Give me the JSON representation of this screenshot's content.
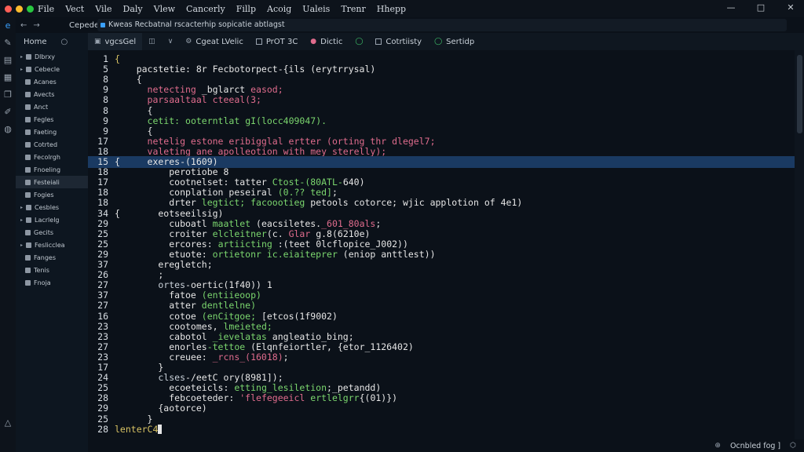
{
  "window": {
    "traffic_lights": [
      "#ff5f57",
      "#febc2e",
      "#28c840"
    ],
    "menu": [
      "File",
      "Vect",
      "Vile",
      "Daly",
      "Vlew",
      "Cancerly",
      "Fillp",
      "Acoig",
      "Ualeis",
      "Trenr",
      "Hhepp"
    ],
    "controls": [
      "—",
      "□",
      "✕"
    ]
  },
  "address_bar": {
    "nav": [
      "←",
      "→"
    ],
    "crumb": "Cepedel",
    "text": "Kweas Recbatnal rscacterhip sopicatie abtlagst"
  },
  "sidebar": {
    "title": "Home",
    "items": [
      {
        "label": "Dlbrxy",
        "indent": 0,
        "arrow": true
      },
      {
        "label": "Cebecle",
        "indent": 0,
        "arrow": true
      },
      {
        "label": "Acanes",
        "indent": 1
      },
      {
        "label": "Avects",
        "indent": 1
      },
      {
        "label": "Anct",
        "indent": 1
      },
      {
        "label": "Fegles",
        "indent": 1
      },
      {
        "label": "Faeting",
        "indent": 1
      },
      {
        "label": "Cotrted",
        "indent": 1
      },
      {
        "label": "Fecolrgh",
        "indent": 1
      },
      {
        "label": "Fnoeling",
        "indent": 1
      },
      {
        "label": "Festeiali",
        "indent": 1,
        "selected": true
      },
      {
        "label": "Fogies",
        "indent": 1
      },
      {
        "label": "Cesbles",
        "indent": 0,
        "arrow": true
      },
      {
        "label": "Lacrlelg",
        "indent": 0,
        "arrow": true
      },
      {
        "label": "Gecits",
        "indent": 1
      },
      {
        "label": "Feslicclea",
        "indent": 0,
        "arrow": true
      },
      {
        "label": "Fanges",
        "indent": 1
      },
      {
        "label": "Tenis",
        "indent": 1
      },
      {
        "label": "Fnoja",
        "indent": 1
      }
    ]
  },
  "tabs": [
    {
      "label": "vgcsGel",
      "icon": "doc",
      "active": true
    },
    {
      "label": "",
      "icon": "split"
    },
    {
      "label": "",
      "icon": "dropdown"
    },
    {
      "label": "Cgeat LVelic",
      "icon": "gear"
    },
    {
      "label": "PrOT 3C",
      "icon": "box"
    },
    {
      "label": "Dictic",
      "icon": "pink-dot"
    },
    {
      "label": "",
      "icon": "green-circle"
    },
    {
      "label": "Cotrtiisty",
      "icon": "box"
    },
    {
      "label": "Sertidp",
      "icon": "green-circle"
    }
  ],
  "editor": {
    "lines": [
      {
        "n": "1",
        "code": [
          [
            "{",
            "y"
          ]
        ]
      },
      {
        "n": "5",
        "code": [
          [
            "    pacstetie: 8r Fecbotorpect-{ils (erytrrysal)",
            "k"
          ]
        ]
      },
      {
        "n": "8",
        "code": [
          [
            "    {",
            "k"
          ]
        ]
      },
      {
        "n": "9",
        "code": [
          [
            "      netecting ",
            "r"
          ],
          [
            "_bglarct",
            "k"
          ],
          [
            " easod;",
            "r"
          ]
        ]
      },
      {
        "n": "8",
        "code": [
          [
            "      parsaaltaal cteeal(3;",
            "r"
          ]
        ]
      },
      {
        "n": "8",
        "code": [
          [
            "      {",
            "k"
          ]
        ]
      },
      {
        "n": "9",
        "code": [
          [
            "      cetit: ",
            "g"
          ],
          [
            "ooterntlat",
            "g"
          ],
          [
            " gI(locc409047).",
            "g"
          ]
        ]
      },
      {
        "n": "9",
        "code": [
          [
            "      {",
            "k"
          ]
        ]
      },
      {
        "n": "17",
        "code": [
          [
            "      netelig estone eribigglal ertter (orting thr dlegel7;",
            "r"
          ]
        ]
      },
      {
        "n": "18",
        "code": [
          [
            "      valeting ane apolleotion with mey sterelly);",
            "r"
          ]
        ]
      },
      {
        "n": "15",
        "hl": true,
        "code": [
          [
            "{     ",
            "k"
          ],
          [
            "exeres-(1609)",
            "k"
          ]
        ]
      },
      {
        "n": "18",
        "code": [
          [
            "          perotiobe 8",
            "k"
          ]
        ]
      },
      {
        "n": "17",
        "code": [
          [
            "          cootnelset: tatter ",
            "k"
          ],
          [
            "Ctost-(80ATL-",
            "g"
          ],
          [
            "640)",
            "k"
          ]
        ]
      },
      {
        "n": "18",
        "code": [
          [
            "          conplation peseiral ",
            "k"
          ],
          [
            "(0.?? ted]",
            "g"
          ],
          [
            ";",
            "k"
          ]
        ]
      },
      {
        "n": "18",
        "code": [
          [
            "          drter ",
            "k"
          ],
          [
            "legtict; facoootieg",
            "g"
          ],
          [
            " petools cotorce; wjic applotion of 4e1)",
            "k"
          ]
        ]
      },
      {
        "n": "34",
        "code": [
          [
            "{       eotseeilsig)",
            "k"
          ]
        ]
      },
      {
        "n": "29",
        "code": [
          [
            "          cuboatl ",
            "k"
          ],
          [
            "maatlet",
            "g"
          ],
          [
            " (eacsiletes.",
            "k"
          ],
          [
            "_601_80als",
            "r"
          ],
          [
            ";",
            "k"
          ]
        ]
      },
      {
        "n": "25",
        "code": [
          [
            "          croiter ",
            "k"
          ],
          [
            "elcleitner",
            "g"
          ],
          [
            "(c. ",
            "k"
          ],
          [
            "Glar",
            "r"
          ],
          [
            " g.8(6210e)",
            "k"
          ]
        ]
      },
      {
        "n": "25",
        "code": [
          [
            "          ercores: ",
            "k"
          ],
          [
            "artiicting",
            "g"
          ],
          [
            " :(teet 0lcflopice_J002))",
            "k"
          ]
        ]
      },
      {
        "n": "29",
        "code": [
          [
            "          etuote: ",
            "k"
          ],
          [
            "ortietonr",
            "g"
          ],
          [
            " ic.eiaiteprer",
            "g"
          ],
          [
            " (eniop anttlest))",
            "k"
          ]
        ]
      },
      {
        "n": "37",
        "code": [
          [
            "        eregletch;",
            "k"
          ]
        ]
      },
      {
        "n": "26",
        "code": [
          [
            "        ;",
            "k"
          ]
        ]
      },
      {
        "n": "27",
        "code": [
          [
            "        ",
            "k"
          ],
          [
            "ortes",
            "b"
          ],
          [
            "-oertic(1f40)) 1",
            "k"
          ]
        ]
      },
      {
        "n": "37",
        "code": [
          [
            "          fatoe ",
            "k"
          ],
          [
            "(entiieoop)",
            "g"
          ]
        ]
      },
      {
        "n": "27",
        "code": [
          [
            "          atter ",
            "k"
          ],
          [
            "dentlelne)",
            "g"
          ]
        ]
      },
      {
        "n": "16",
        "code": [
          [
            "          cotoe ",
            "k"
          ],
          [
            "(enCitgoe;",
            "g"
          ],
          [
            " [etcos(1f9002)",
            "k"
          ]
        ]
      },
      {
        "n": "23",
        "code": [
          [
            "          cootomes, ",
            "k"
          ],
          [
            "lmeieted;",
            "g"
          ]
        ]
      },
      {
        "n": "23",
        "code": [
          [
            "          cabotol ",
            "k"
          ],
          [
            "_ievelatas",
            "g"
          ],
          [
            " angleatio_bing;",
            "k"
          ]
        ]
      },
      {
        "n": "27",
        "code": [
          [
            "          enorles",
            "k"
          ],
          [
            "-tettoe",
            "g"
          ],
          [
            " (Elqnfeiortler, {etor_1126402)",
            "k"
          ]
        ]
      },
      {
        "n": "23",
        "code": [
          [
            "          creuee: ",
            "k"
          ],
          [
            "_rcns_(16018)",
            "r"
          ],
          [
            ";",
            "k"
          ]
        ]
      },
      {
        "n": "17",
        "code": [
          [
            "        }",
            "k"
          ]
        ]
      },
      {
        "n": "24",
        "code": [
          [
            "        ",
            "k"
          ],
          [
            "clses",
            "b"
          ],
          [
            "-/eetC ory(8981]);",
            "k"
          ]
        ]
      },
      {
        "n": "25",
        "code": [
          [
            "          ecoeteicls: ",
            "k"
          ],
          [
            "etting_lesiletion",
            "g"
          ],
          [
            ";_petandd)",
            "k"
          ]
        ]
      },
      {
        "n": "28",
        "code": [
          [
            "          febcoeteder: ",
            "k"
          ],
          [
            "'flefegeeicl",
            "r"
          ],
          [
            " ertlelgrr",
            "g"
          ],
          [
            "{(01)})",
            "k"
          ]
        ]
      },
      {
        "n": "29",
        "code": [
          [
            "        {aotorce)",
            "k"
          ]
        ]
      },
      {
        "n": "25",
        "code": [
          [
            "      }",
            "k"
          ]
        ]
      },
      {
        "n": "28",
        "code": [
          [
            "lenterC4",
            "y"
          ]
        ],
        "cursor": true
      }
    ]
  },
  "statusbar": {
    "items": [
      "Ocnbled fog ]",
      "⬡"
    ],
    "left_icon": "⊕"
  }
}
